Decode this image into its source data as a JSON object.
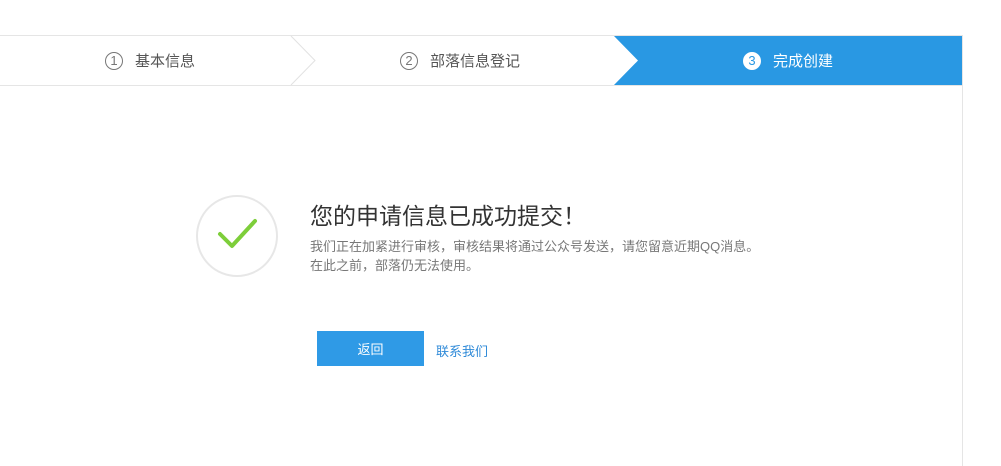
{
  "steps": [
    {
      "num": "1",
      "label": "基本信息",
      "state": "done"
    },
    {
      "num": "2",
      "label": "部落信息登记",
      "state": "done"
    },
    {
      "num": "3",
      "label": "完成创建",
      "state": "active"
    }
  ],
  "colors": {
    "accent": "#2998e3",
    "check": "#7dce3a",
    "link": "#2f8ad8"
  },
  "result": {
    "icon": "check-icon",
    "title": "您的申请信息已成功提交！",
    "description_line1": "我们正在加紧进行审核，审核结果将通过公众号发送，请您留意近期QQ消息。",
    "description_line2": "在此之前，部落仍无法使用。"
  },
  "actions": {
    "back_label": "返回",
    "contact_label": "联系我们"
  }
}
